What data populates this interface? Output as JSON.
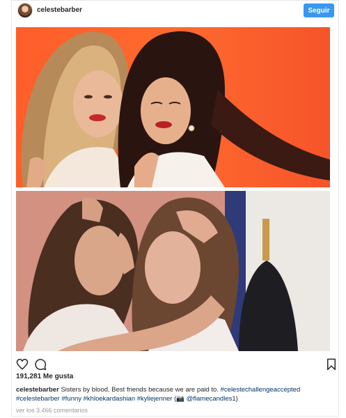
{
  "header": {
    "username": "celestebarber",
    "follow_label": "Seguir"
  },
  "post": {
    "likes": "191,281 Me gusta",
    "caption_user": "celestebarber",
    "caption_text": "Sisters by blood. Best friends because we are paid to.",
    "hashtags_line1": "#celestechallengeaccepted",
    "hashtags_line2": "#celestebarber #funny #khloekardashian #kyliejenner",
    "mention": "@flamecandles1",
    "view_comments": "ver los 3.466 comentarios"
  },
  "colors": {
    "accent": "#3897f0",
    "hashtag": "#003569",
    "orange_bg": "#ff5e2a"
  },
  "icons": [
    "heart-icon",
    "comment-icon",
    "bookmark-icon",
    "camera-icon"
  ]
}
